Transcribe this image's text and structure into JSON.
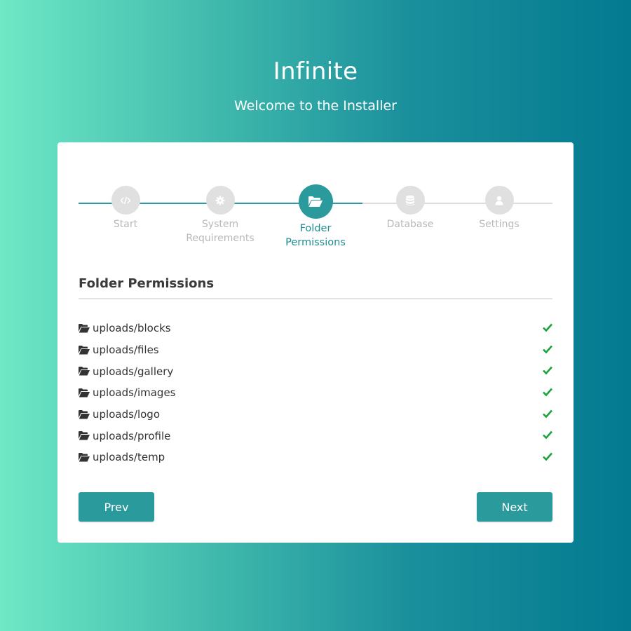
{
  "header": {
    "title": "Infinite",
    "subtitle": "Welcome to the Installer"
  },
  "steps": [
    {
      "label": "Start",
      "icon": "code-icon",
      "state": "done"
    },
    {
      "label": "System Requirements",
      "icon": "gear-icon",
      "state": "done"
    },
    {
      "label": "Folder Permissions",
      "icon": "folder-open-icon",
      "state": "active"
    },
    {
      "label": "Database",
      "icon": "database-icon",
      "state": "pending"
    },
    {
      "label": "Settings",
      "icon": "user-icon",
      "state": "pending"
    }
  ],
  "section": {
    "title": "Folder Permissions"
  },
  "folders": [
    {
      "name": "uploads/blocks",
      "status": "ok"
    },
    {
      "name": "uploads/files",
      "status": "ok"
    },
    {
      "name": "uploads/gallery",
      "status": "ok"
    },
    {
      "name": "uploads/images",
      "status": "ok"
    },
    {
      "name": "uploads/logo",
      "status": "ok"
    },
    {
      "name": "uploads/profile",
      "status": "ok"
    },
    {
      "name": "uploads/temp",
      "status": "ok"
    }
  ],
  "buttons": {
    "prev": "Prev",
    "next": "Next"
  },
  "colors": {
    "accent": "#2a9a9c",
    "check": "#1aa33a",
    "inactive": "#e0e0e0"
  }
}
